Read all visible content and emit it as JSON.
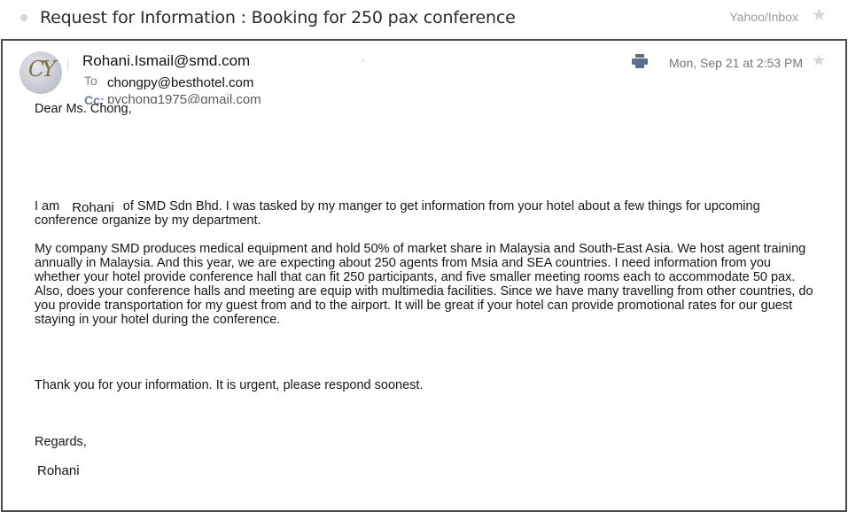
{
  "subject_bar": {
    "subject": "Request for Information : Booking for 250 pax conference",
    "folder": "Yahoo/Inbox",
    "star_icon": "star-icon"
  },
  "message": {
    "avatar_initials": "CY",
    "sender": "Rohani.Ismail@smd.com",
    "to_label": "To",
    "to_value": "chongpy@besthotel.com",
    "cc_label": "Cc:",
    "cc_value": "pychong1975@gmail.com",
    "date": "Mon, Sep 21 at 2:53 PM",
    "print_icon": "print-icon",
    "chevron": "›",
    "star": "★"
  },
  "body": {
    "greeting": "Dear Ms. Chong,",
    "para1_prefix": "I am",
    "para1_name": "Rohani",
    "para1_rest": "of SMD Sdn Bhd. I was tasked by my manger to get information from your hotel about a few things for upcoming conference organize by my department.",
    "para2": "My company SMD produces medical equipment and hold 50% of market share in Malaysia and South-East Asia.  We host agent training annually in Malaysia. And this year, we are expecting about 250 agents from Msia and SEA countries.  I need information from you whether your hotel provide conference hall that can fit 250 participants, and five smaller meeting rooms each to accommodate 50 pax. Also, does your conference halls and meeting are equip with multimedia facilities. Since we have many travelling from other countries, do you provide transportation for my guest from and to the airport. It will be great if your hotel can provide promotional rates for our guest staying in your hotel during the conference.",
    "thanks": "Thank you for your information. It is urgent, please respond soonest.",
    "regards": "Regards,",
    "signature": "Rohani"
  }
}
